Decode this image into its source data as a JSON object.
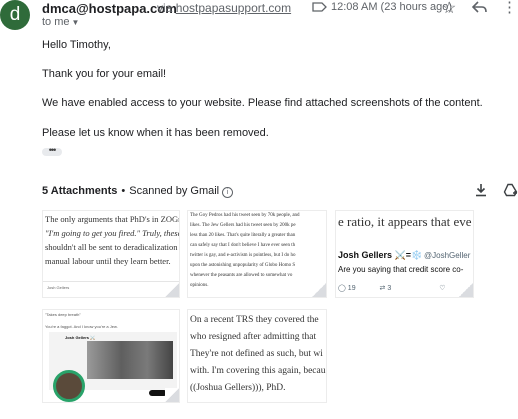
{
  "header": {
    "avatar_letter": "d",
    "sender": "dmca@hostpapa.com",
    "via_prefix": "via",
    "via_domain": "hostpapasupport.com",
    "to_label": "to me",
    "timestamp": "12:08 AM (23 hours ago)"
  },
  "body": {
    "greeting": "Hello Timothy,",
    "line1": "Thank you for your email!",
    "line2": "We have enabled access to your website. Please find attached screenshots of the content.",
    "line3": "Please let us know when it has been removed."
  },
  "attachments": {
    "count_label": "5 Attachments",
    "separator": "•",
    "scan_label": "Scanned by Gmail",
    "thumb1": {
      "lines": [
        "The only arguments that PhD's in ZOGn",
        "\"I'm going to get you fired.\" Truly, these are",
        "shouldn't all be sent to deradicalization",
        "manual labour until they learn better."
      ],
      "footer": "Josh Gellers"
    },
    "thumb2": {
      "lines": [
        "The Goy Pedros had his tweet seen by 70k people, and",
        "likes. The Jew Gellers had his tweet seen by 200k pe",
        "less than 20 likes. That's quite literally a greater than",
        "can safely say that I don't believe I have ever seen th",
        "twitter is gay, and e-activism is pointless, but I do ho",
        "upon the astonishing unpopularity of Globo Homo S",
        "whenever the peasants are allowed to somewhat vo",
        "opinions."
      ]
    },
    "thumb3": {
      "headline": "e ratio, it appears that eve",
      "name": "Josh Gellers ⚔️=❄️",
      "handle": "@JoshGeller",
      "tweet": "Are you saying that credit score co-",
      "replies": "19",
      "retweets": "3"
    },
    "thumb4": {
      "line1": "\"Takes deep breath\"",
      "line2": "You're a faggot. And I know you're a Jew.",
      "name": "Josh Gellers ⚔️"
    },
    "thumb5": {
      "lines": [
        "On a recent TRS they covered the",
        "who resigned after admitting that",
        "They're not defined as such, but wi",
        "with. I'm covering this again, becau",
        "((Joshua Gellers))), PhD."
      ]
    }
  },
  "icons": {
    "avatar": "avatar",
    "label": "label-icon",
    "star": "star-icon",
    "reply": "reply-icon",
    "more": "more-vert-icon",
    "info": "info-icon",
    "download": "download-icon",
    "drive": "add-to-drive-icon"
  },
  "colors": {
    "avatar_bg": "#2f6b3a",
    "muted_text": "#5f6368"
  }
}
